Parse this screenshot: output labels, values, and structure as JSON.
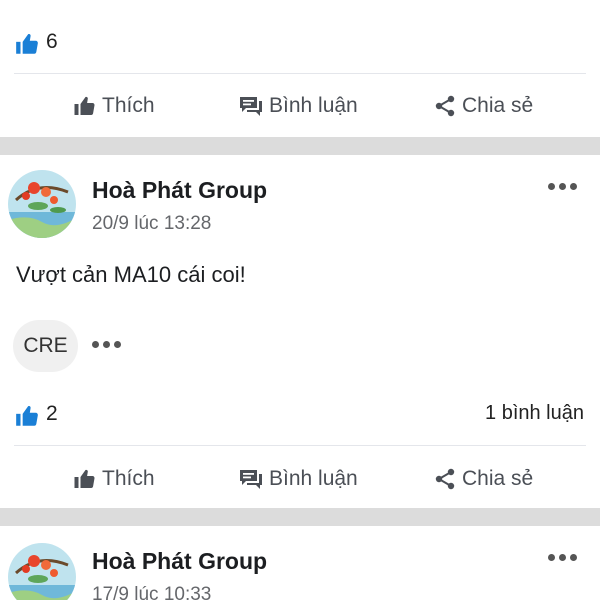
{
  "top_post": {
    "like_count": "6",
    "actions": {
      "like": "Thích",
      "comment": "Bình luận",
      "share": "Chia sẻ"
    }
  },
  "post1": {
    "author": "Hoà Phát Group",
    "timestamp": "20/9 lúc 13:28",
    "text": "Vượt cản MA10 cái coi!",
    "tag": "CRE",
    "like_count": "2",
    "comment_count": "1 bình luận",
    "actions": {
      "like": "Thích",
      "comment": "Bình luận",
      "share": "Chia sẻ"
    }
  },
  "post2": {
    "author": "Hoà Phát Group",
    "timestamp": "17/9 lúc 10:33"
  },
  "colors": {
    "like_blue": "#1a7fd6",
    "action_gray": "#4b4f56",
    "divider": "#dcdcdc"
  }
}
